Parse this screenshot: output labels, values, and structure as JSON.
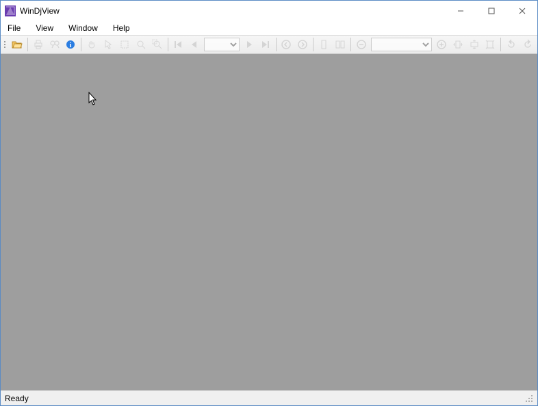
{
  "window": {
    "title": "WinDjView"
  },
  "menu": {
    "file": "File",
    "view": "View",
    "window": "Window",
    "help": "Help"
  },
  "toolbar": {
    "page_value": "",
    "zoom_value": ""
  },
  "status": {
    "text": "Ready"
  }
}
